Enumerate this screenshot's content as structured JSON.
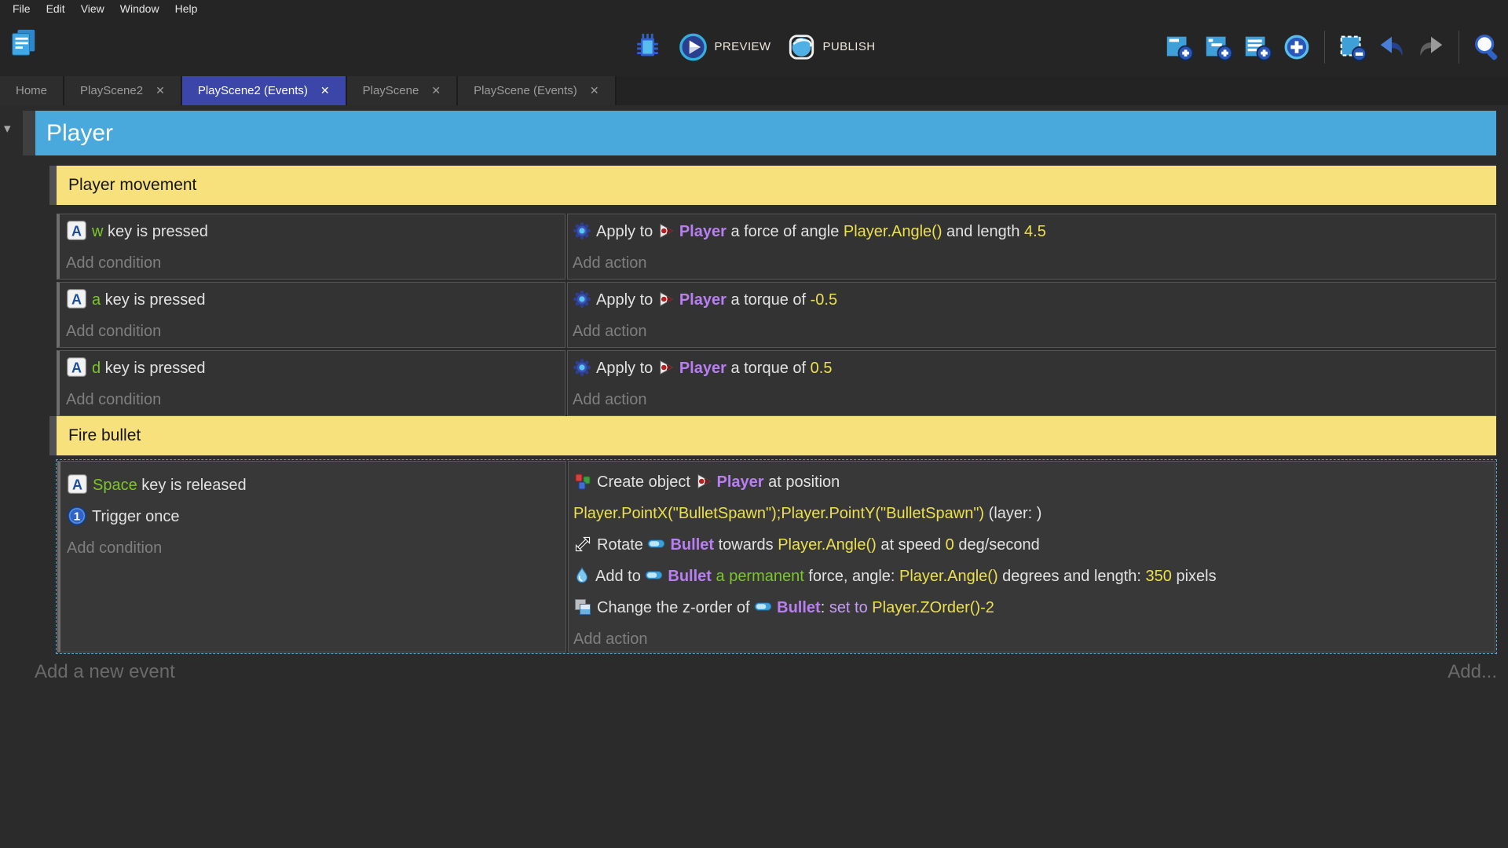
{
  "menu_bar": {
    "items": [
      "File",
      "Edit",
      "View",
      "Window",
      "Help"
    ]
  },
  "toolbar": {
    "project_icon": "project-manager-icon",
    "center_icons": [
      "debug-icon",
      "preview-play-icon",
      "publish-sphere-icon"
    ],
    "preview_label": "PREVIEW",
    "publish_label": "PUBLISH",
    "right_icons": [
      "add-event-icon",
      "add-subevent-icon",
      "add-comment-icon",
      "add-circle-icon",
      "delete-selection-icon",
      "undo-icon",
      "redo-icon",
      "search-icon"
    ]
  },
  "close_glyph": "✕",
  "collapse_glyph": "▾",
  "tabs": [
    {
      "label": "Home",
      "active": false,
      "closable": false
    },
    {
      "label": "PlayScene2",
      "active": false,
      "closable": true
    },
    {
      "label": "PlayScene2 (Events)",
      "active": true,
      "closable": true
    },
    {
      "label": "PlayScene",
      "active": false,
      "closable": true
    },
    {
      "label": "PlayScene (Events)",
      "active": false,
      "closable": true
    }
  ],
  "sheet": {
    "object_header": "Player",
    "groups": [
      {
        "label": "Player movement",
        "color": "#f6e17c"
      },
      {
        "label": "Fire bullet",
        "color": "#f6e17c"
      }
    ],
    "events": [
      {
        "add_condition": "Add condition",
        "add_action": "Add action",
        "conditions": [
          [
            {
              "icon": "keyboard-icon"
            },
            {
              "t": "w",
              "c": "green"
            },
            {
              "t": " key is pressed"
            }
          ]
        ],
        "actions": [
          [
            {
              "icon": "physics-icon"
            },
            {
              "t": "Apply to "
            },
            {
              "icon": "player-object-icon"
            },
            {
              "t": "Player",
              "c": "object"
            },
            {
              "t": " a force of angle "
            },
            {
              "t": "Player.Angle()",
              "c": "expr"
            },
            {
              "t": " and length "
            },
            {
              "t": "4.5",
              "c": "expr"
            }
          ]
        ]
      },
      {
        "add_condition": "Add condition",
        "add_action": "Add action",
        "conditions": [
          [
            {
              "icon": "keyboard-icon"
            },
            {
              "t": "a",
              "c": "green"
            },
            {
              "t": " key is pressed"
            }
          ]
        ],
        "actions": [
          [
            {
              "icon": "physics-icon"
            },
            {
              "t": "Apply to "
            },
            {
              "icon": "player-object-icon"
            },
            {
              "t": "Player",
              "c": "object"
            },
            {
              "t": " a torque of "
            },
            {
              "t": "-0.5",
              "c": "expr"
            }
          ]
        ]
      },
      {
        "add_condition": "Add condition",
        "add_action": "Add action",
        "conditions": [
          [
            {
              "icon": "keyboard-icon"
            },
            {
              "t": "d",
              "c": "green"
            },
            {
              "t": " key is pressed"
            }
          ]
        ],
        "actions": [
          [
            {
              "icon": "physics-icon"
            },
            {
              "t": "Apply to "
            },
            {
              "icon": "player-object-icon"
            },
            {
              "t": "Player",
              "c": "object"
            },
            {
              "t": " a torque of "
            },
            {
              "t": "0.5",
              "c": "expr"
            }
          ]
        ]
      },
      {
        "selected": true,
        "add_condition": "Add condition",
        "add_action": "Add action",
        "conditions": [
          [
            {
              "icon": "keyboard-icon"
            },
            {
              "t": "Space",
              "c": "green"
            },
            {
              "t": " key is released"
            }
          ],
          [
            {
              "icon": "trigger-once-icon"
            },
            {
              "t": "Trigger once"
            }
          ]
        ],
        "actions": [
          [
            {
              "icon": "create-object-icon"
            },
            {
              "t": "Create object "
            },
            {
              "icon": "player-object-icon"
            },
            {
              "t": "Player",
              "c": "object"
            },
            {
              "t": " at position "
            },
            {
              "br": true
            },
            {
              "t": "Player.PointX(\"BulletSpawn\");Player.PointY(\"BulletSpawn\")",
              "c": "expr"
            },
            {
              "t": " (layer: )"
            }
          ],
          [
            {
              "icon": "rotate-icon"
            },
            {
              "t": "Rotate "
            },
            {
              "icon": "bullet-object-icon"
            },
            {
              "t": "Bullet",
              "c": "object"
            },
            {
              "t": " towards "
            },
            {
              "t": "Player.Angle()",
              "c": "expr"
            },
            {
              "t": " at speed "
            },
            {
              "t": "0",
              "c": "expr"
            },
            {
              "t": " deg/second"
            }
          ],
          [
            {
              "icon": "force-icon"
            },
            {
              "t": "Add to "
            },
            {
              "icon": "bullet-object-icon"
            },
            {
              "t": "Bullet",
              "c": "object"
            },
            {
              "t": " a permanent",
              "c": "green"
            },
            {
              "t": " force, angle: "
            },
            {
              "t": "Player.Angle()",
              "c": "expr"
            },
            {
              "t": " degrees and length: "
            },
            {
              "t": "350",
              "c": "expr"
            },
            {
              "t": " pixels"
            }
          ],
          [
            {
              "icon": "zorder-icon"
            },
            {
              "t": "Change the z-order of "
            },
            {
              "icon": "bullet-object-icon"
            },
            {
              "t": "Bullet",
              "c": "object"
            },
            {
              "t": ": "
            },
            {
              "t": "set to ",
              "c": "setto"
            },
            {
              "t": "Player.ZOrder()-2",
              "c": "expr"
            }
          ]
        ]
      }
    ],
    "add_new_event": "Add a new event",
    "add_more": "Add..."
  },
  "colors": {
    "active_tab": "#3c46a8",
    "object_header_blue": "#49a9dd",
    "group_yellow": "#f6e17c",
    "string_green": "#7cc62b",
    "object_name_purple": "#b97ef2",
    "expression_yellow": "#ece04e",
    "selection_border_blue": "#58a8d5"
  }
}
